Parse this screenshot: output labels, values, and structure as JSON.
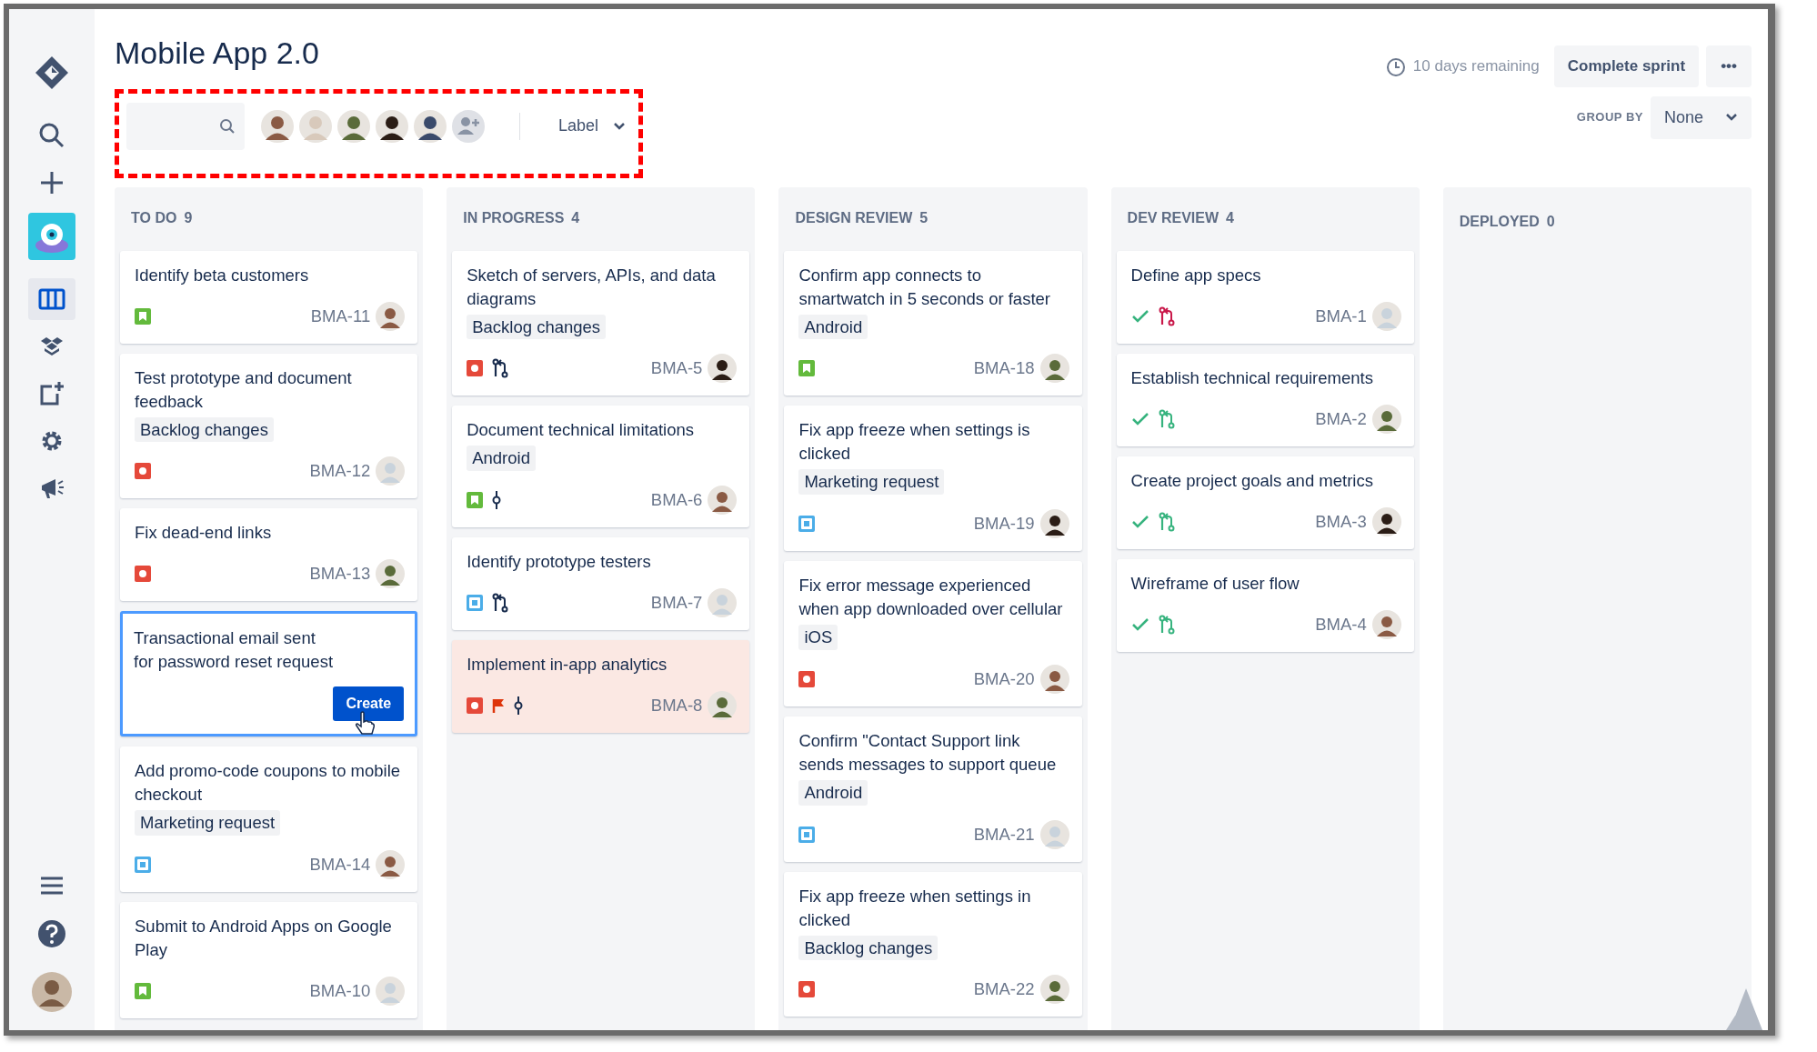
{
  "sidebar": {
    "items": [
      {
        "kind": "logo",
        "selected": false
      },
      {
        "kind": "search",
        "selected": false
      },
      {
        "kind": "create",
        "selected": false
      },
      {
        "kind": "project",
        "selected": false
      },
      {
        "kind": "board",
        "selected": true
      },
      {
        "kind": "releases",
        "selected": false
      },
      {
        "kind": "pages",
        "selected": false
      },
      {
        "kind": "settings",
        "selected": false
      },
      {
        "kind": "feedback",
        "selected": false
      }
    ],
    "bottom": [
      {
        "kind": "menu"
      },
      {
        "kind": "help"
      },
      {
        "kind": "profile"
      }
    ]
  },
  "header": {
    "title": "Mobile App 2.0",
    "remaining": "10 days remaining",
    "complete_button": "Complete sprint",
    "more_button": "•••"
  },
  "filters": {
    "highlighted": true,
    "avatars": [
      {
        "kind": "person"
      },
      {
        "kind": "person"
      },
      {
        "kind": "person"
      },
      {
        "kind": "person"
      },
      {
        "kind": "person"
      },
      {
        "kind": "add"
      }
    ],
    "label_dropdown": "Label",
    "group_by_label": "GROUP BY",
    "group_by_value": "None"
  },
  "columns": [
    {
      "name": "TO DO",
      "count": "9",
      "cards": [
        {
          "title": "Identify beta customers",
          "kind": "story",
          "key": "BMA-11"
        },
        {
          "title": "Test prototype and document feedback",
          "label": "Backlog changes",
          "kind": "bug",
          "key": "BMA-12"
        },
        {
          "title": "Fix dead-end links",
          "kind": "bug",
          "key": "BMA-13"
        },
        {
          "kind": "editing",
          "title": "Transactional email sent\nfor password reset request",
          "button": "Create"
        },
        {
          "title": "Add promo-code coupons to mobile checkout",
          "label": "Marketing request",
          "kind": "task",
          "key": "BMA-14"
        },
        {
          "title": "Submit to Android Apps on Google Play",
          "kind": "story",
          "key": "BMA-10"
        }
      ]
    },
    {
      "name": "IN PROGRESS",
      "count": "4",
      "cards": [
        {
          "title": "Sketch of servers, APIs, and data diagrams",
          "label": "Backlog changes",
          "kind": "bug",
          "key": "BMA-5",
          "badges": [
            {
              "kind": "pull-request",
              "color": "#172b4d"
            }
          ]
        },
        {
          "title": "Document technical limitations",
          "label": "Android",
          "kind": "story",
          "key": "BMA-6",
          "badges": [
            {
              "kind": "commit",
              "color": "#172b4d"
            }
          ]
        },
        {
          "title": "Identify prototype testers",
          "kind": "task",
          "key": "BMA-7",
          "badges": [
            {
              "kind": "pull-request",
              "color": "#172b4d"
            }
          ]
        },
        {
          "title": "Implement in-app analytics",
          "kind": "bug",
          "key": "BMA-8",
          "flagged": true,
          "badges": [
            {
              "kind": "flag",
              "color": "#de350b"
            },
            {
              "kind": "commit",
              "color": "#172b4d"
            }
          ]
        }
      ]
    },
    {
      "name": "DESIGN REVIEW",
      "count": "5",
      "cards": [
        {
          "title": "Confirm app connects to smartwatch in 5 seconds or faster",
          "label": "Android",
          "kind": "story",
          "key": "BMA-18"
        },
        {
          "title": "Fix app freeze when settings is clicked",
          "label": "Marketing request",
          "kind": "task",
          "key": "BMA-19"
        },
        {
          "title": "Fix error message experienced when app downloaded over cellular",
          "label": "iOS",
          "kind": "bug",
          "key": "BMA-20"
        },
        {
          "title": "Confirm \"Contact Support link sends messages to support queue",
          "label": "Android",
          "kind": "task",
          "key": "BMA-21"
        },
        {
          "title": "Fix app freeze when settings in clicked",
          "label": "Backlog changes",
          "kind": "bug",
          "key": "BMA-22"
        }
      ]
    },
    {
      "name": "DEV REVIEW",
      "count": "4",
      "cards": [
        {
          "title": "Define app specs",
          "kind": "plain",
          "key": "BMA-1",
          "badges": [
            {
              "kind": "done",
              "color": "#36b37e"
            },
            {
              "kind": "pull-request",
              "color": "#c9184a"
            }
          ]
        },
        {
          "title": "Establish technical requirements",
          "kind": "plain",
          "key": "BMA-2",
          "badges": [
            {
              "kind": "done",
              "color": "#36b37e"
            },
            {
              "kind": "pull-request",
              "color": "#36b37e"
            }
          ]
        },
        {
          "title": "Create project goals and metrics",
          "kind": "plain",
          "key": "BMA-3",
          "badges": [
            {
              "kind": "done",
              "color": "#36b37e"
            },
            {
              "kind": "pull-request",
              "color": "#36b37e"
            }
          ]
        },
        {
          "title": "Wireframe of user flow",
          "kind": "plain",
          "key": "BMA-4",
          "badges": [
            {
              "kind": "done",
              "color": "#36b37e"
            },
            {
              "kind": "pull-request",
              "color": "#36b37e"
            }
          ]
        }
      ]
    },
    {
      "name": "DEPLOYED",
      "count": "0"
    }
  ]
}
